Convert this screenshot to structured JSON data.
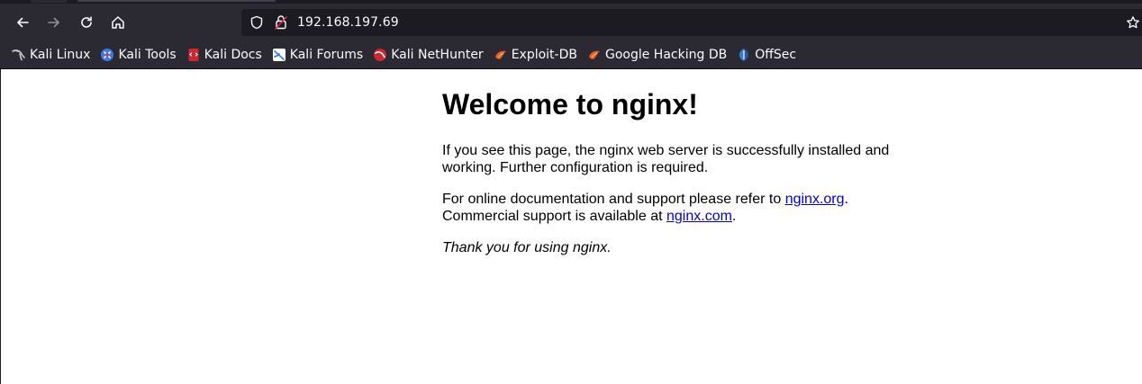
{
  "browser": {
    "url": "192.168.197.69",
    "colors": {
      "chrome_bg": "#2b2a33",
      "urlbar_bg": "#1c1b22",
      "text": "#fbfbfe",
      "link": "#0000ee"
    },
    "nav_icons": [
      "back-arrow-icon",
      "forward-arrow-icon",
      "reload-icon",
      "home-icon"
    ],
    "url_icons": [
      "shield-icon",
      "insecure-lock-icon",
      "star-icon"
    ]
  },
  "bookmarks": [
    {
      "label": "Kali Linux",
      "icon": "kali-dragon-icon"
    },
    {
      "label": "Kali Tools",
      "icon": "kali-tools-icon"
    },
    {
      "label": "Kali Docs",
      "icon": "kali-docs-icon"
    },
    {
      "label": "Kali Forums",
      "icon": "kali-forums-icon"
    },
    {
      "label": "Kali NetHunter",
      "icon": "kali-nethunter-icon"
    },
    {
      "label": "Exploit-DB",
      "icon": "exploit-db-icon"
    },
    {
      "label": "Google Hacking DB",
      "icon": "ghdb-icon"
    },
    {
      "label": "OffSec",
      "icon": "offsec-icon"
    }
  ],
  "page": {
    "title": "Welcome to nginx!",
    "para1": "If you see this page, the nginx web server is successfully installed and working. Further configuration is required.",
    "para2_prefix": "For online documentation and support please refer to ",
    "para2_link1": "nginx.org",
    "para2_mid": ".",
    "para2_line2_prefix": "Commercial support is available at ",
    "para2_link2": "nginx.com",
    "para2_suffix": ".",
    "thanks": "Thank you for using nginx."
  }
}
